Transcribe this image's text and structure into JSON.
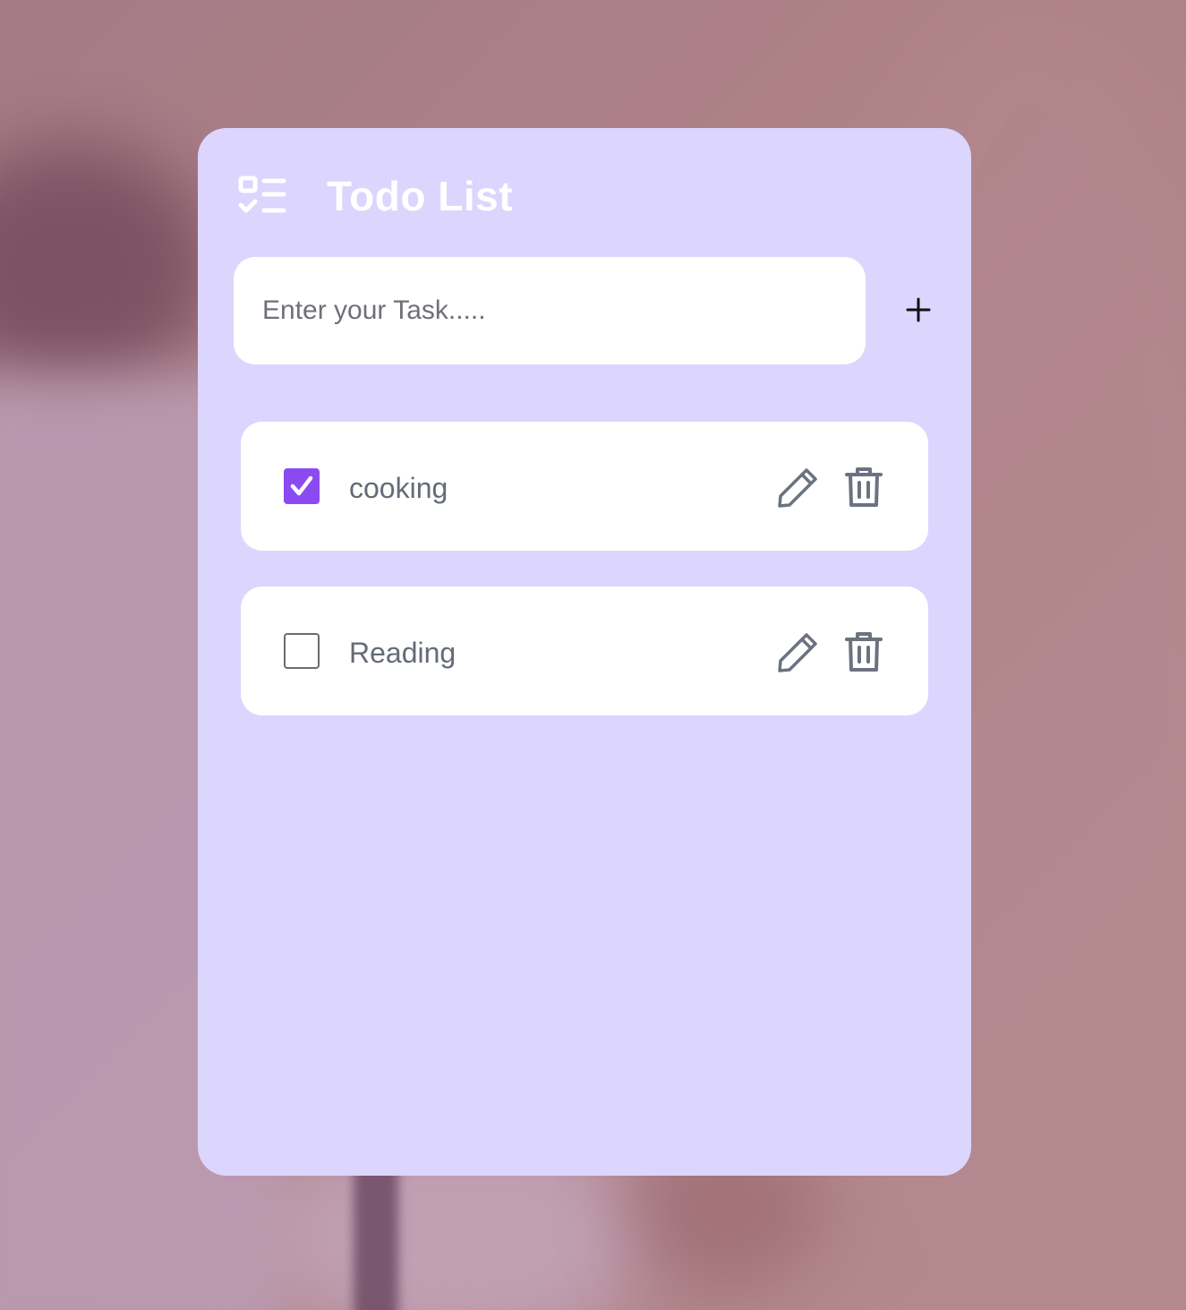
{
  "app": {
    "title": "Todo List",
    "icon": "checklist-icon",
    "accent_color": "#8b4af0",
    "card_color": "#dcd5fd"
  },
  "input": {
    "value": "",
    "placeholder": "Enter your Task.....",
    "add_icon": "plus-icon"
  },
  "todos": [
    {
      "text": "cooking",
      "done": true,
      "edit_icon": "pencil-icon",
      "delete_icon": "trash-icon"
    },
    {
      "text": "Reading",
      "done": false,
      "edit_icon": "pencil-icon",
      "delete_icon": "trash-icon"
    }
  ]
}
